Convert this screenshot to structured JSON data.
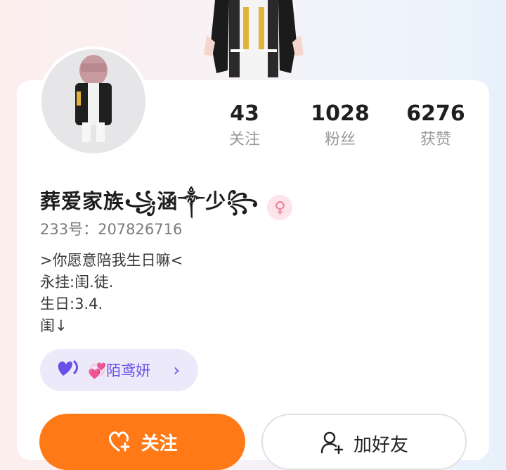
{
  "profile": {
    "nickname": "葬爱家族꧁涵༒少꧂",
    "gender_symbol": "♀",
    "uid": "233号：207826716",
    "bio": [
      ">你愿意陪我生日嘛<",
      "永挂:闺.徒.",
      "生日:3.4.",
      "闺↓"
    ]
  },
  "stats": [
    {
      "value": "43",
      "label": "关注"
    },
    {
      "value": "1028",
      "label": "粉丝"
    },
    {
      "value": "6276",
      "label": "获赞"
    }
  ],
  "tag": {
    "icon": "heart-icon",
    "label": "💞陌鸢妍",
    "chevron": "›"
  },
  "actions": {
    "follow_label": "关注",
    "add_friend_label": "加好友"
  },
  "colors": {
    "accent_orange": "#ff7a16",
    "tag_purple": "#6a4ee8",
    "gender_pink": "#f07a9c"
  }
}
